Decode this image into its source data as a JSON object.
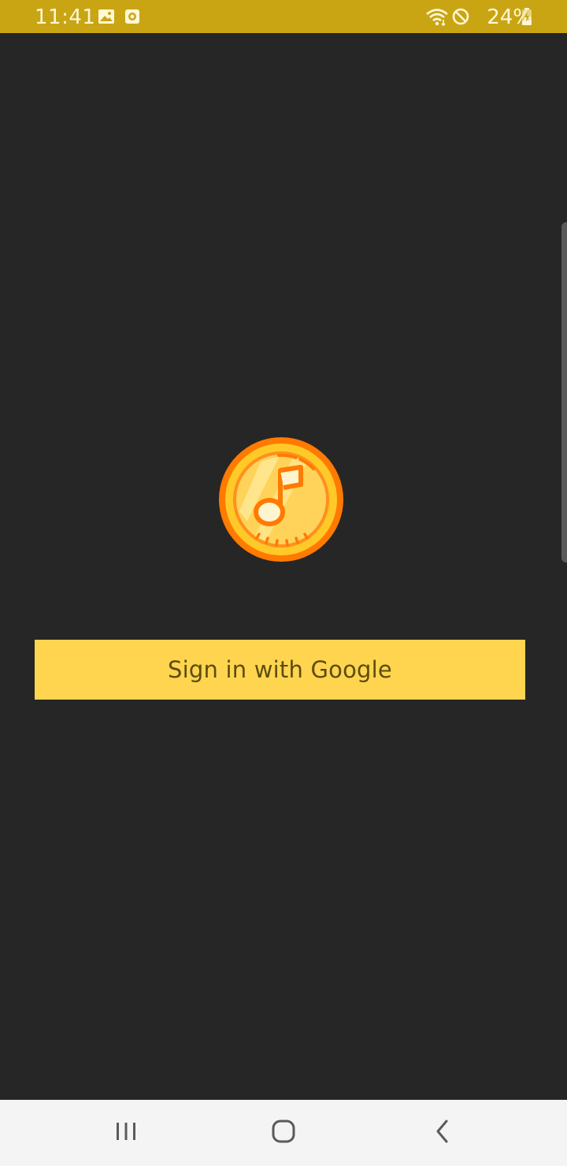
{
  "status_bar": {
    "time": "11:41",
    "battery_percent": "24%",
    "left_icons": [
      "image-notification-icon",
      "screen-recorder-icon"
    ],
    "right_icons": [
      "wifi-icon",
      "do-not-disturb-icon",
      "battery-charging-icon"
    ],
    "background_color": "#c9a514"
  },
  "app": {
    "logo_icon": "music-note-coin-icon",
    "sign_in_label": "Sign in with Google",
    "button_color": "#ffd54f",
    "background_color": "#262626"
  },
  "nav_bar": {
    "buttons": [
      "recent-apps-icon",
      "home-icon",
      "back-icon"
    ]
  }
}
